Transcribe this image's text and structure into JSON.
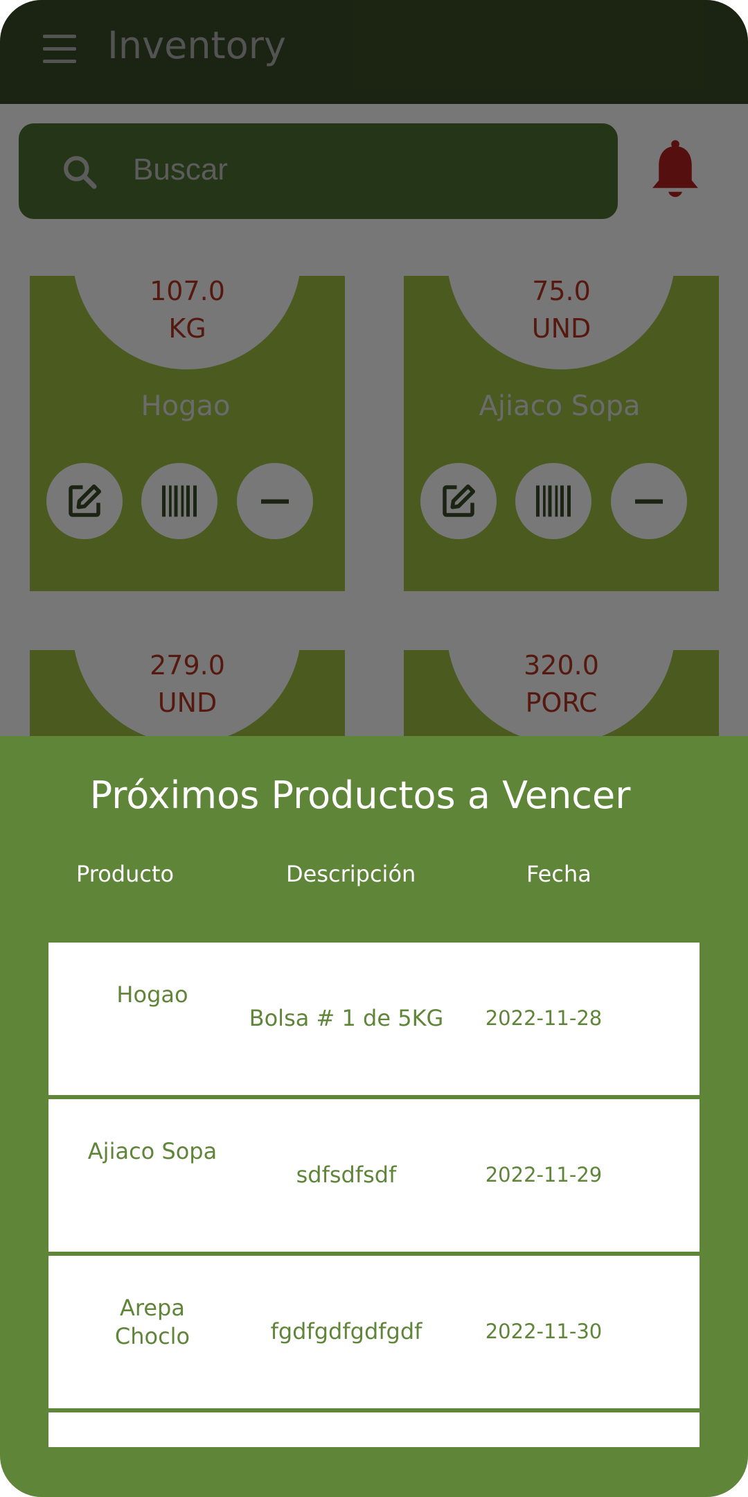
{
  "app_bar": {
    "title": "Inventory",
    "menu_icon": "menu-icon"
  },
  "search": {
    "placeholder": "Buscar",
    "icon": "search-icon"
  },
  "notification": {
    "icon": "bell-icon",
    "color": "#8e1a1a"
  },
  "products": [
    {
      "qty": "107.0",
      "unit": "KG",
      "name": "Hogao"
    },
    {
      "qty": "75.0",
      "unit": "UND",
      "name": "Ajiaco Sopa"
    },
    {
      "qty": "279.0",
      "unit": "UND",
      "name": ""
    },
    {
      "qty": "320.0",
      "unit": "PORC",
      "name": ""
    }
  ],
  "card_actions": [
    "edit-icon",
    "barcode-icon",
    "minus-icon"
  ],
  "expiring_sheet": {
    "title": "Próximos Productos a Vencer",
    "headers": {
      "product": "Producto",
      "description": "Descripción",
      "date": "Fecha"
    },
    "rows": [
      {
        "product": "Hogao",
        "description": "Bolsa # 1 de 5KG",
        "date": "2022-11-28"
      },
      {
        "product": "Ajiaco Sopa",
        "description": "sdfsdfsdf",
        "date": "2022-11-29"
      },
      {
        "product": "Arepa Choclo",
        "description": "fgdfgdfgdfgdf",
        "date": "2022-11-30"
      }
    ]
  },
  "colors": {
    "app_bar": "#2d3d1e",
    "card": "#7d9735",
    "sheet": "#5f8539",
    "quantity_text": "#8e2a1c"
  }
}
